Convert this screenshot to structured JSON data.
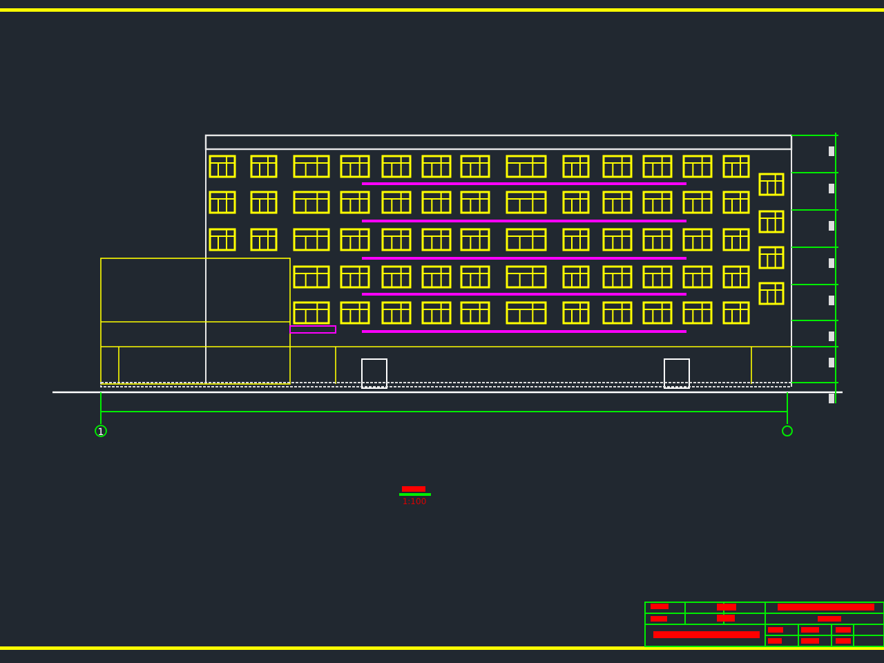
{
  "drawing": {
    "axis_label": "1",
    "scale": "1:100"
  }
}
